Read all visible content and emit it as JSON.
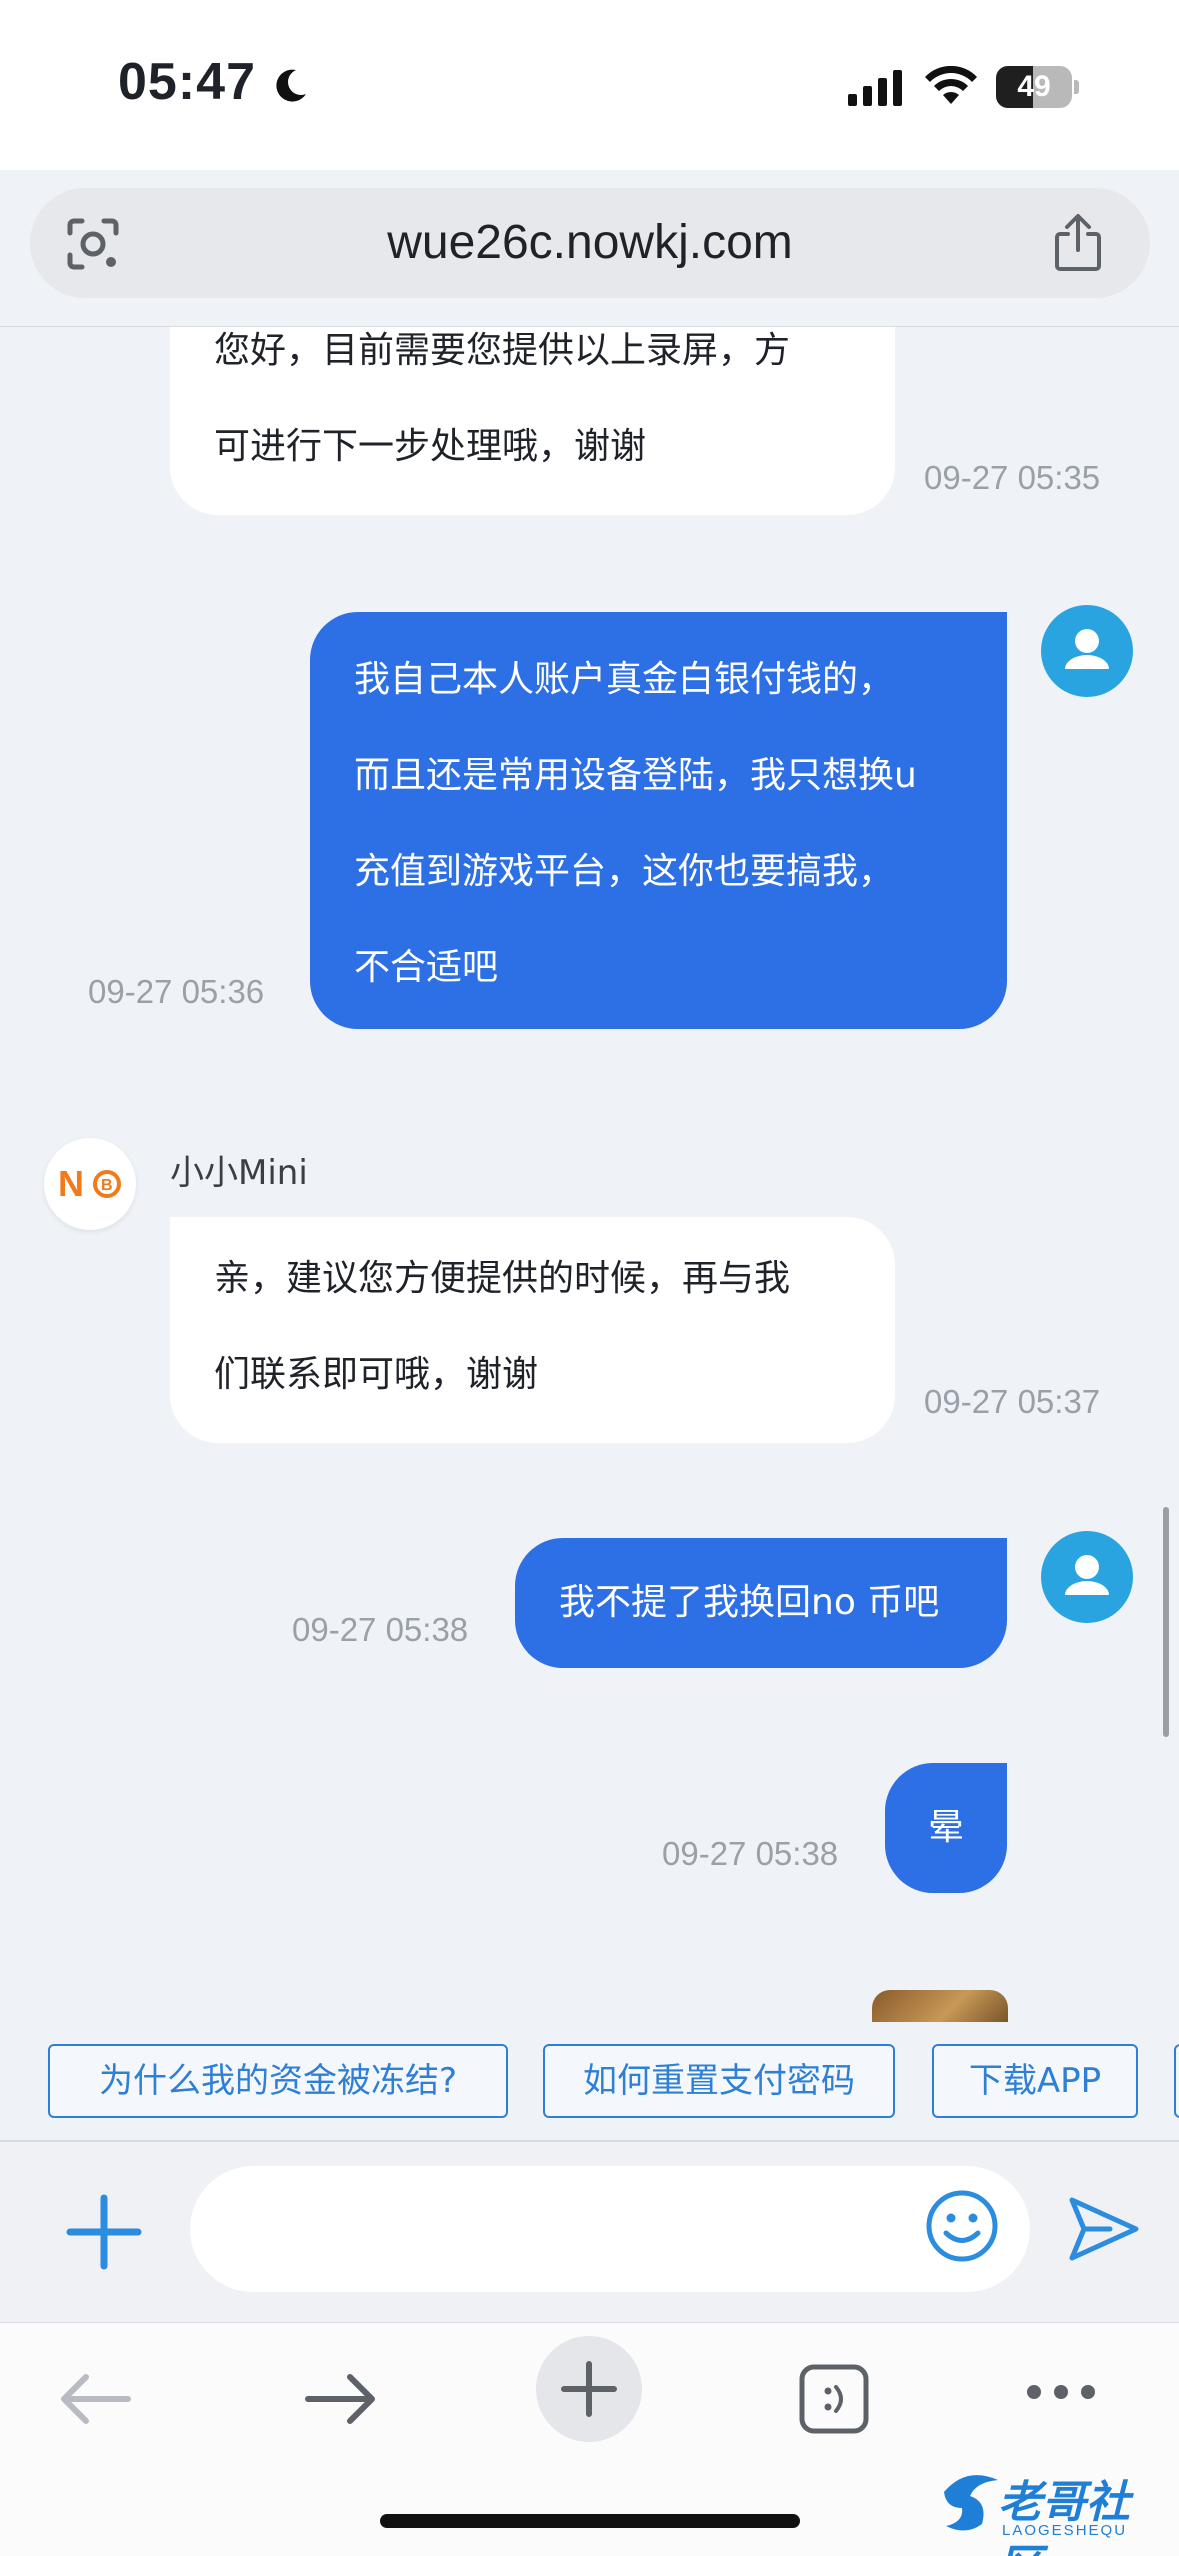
{
  "status": {
    "time": "05:47",
    "battery": "49",
    "battery_level": 0.49
  },
  "browser": {
    "url": "wue26c.nowkj.com"
  },
  "agent": {
    "name": "小小Mini",
    "avatar_text": "N",
    "avatar_coin": "B"
  },
  "messages": [
    {
      "sender": "agent",
      "lines": [
        "您好，目前需要您提供以上录屏，方",
        "可进行下一步处理哦，谢谢"
      ],
      "timestamp": "09-27 05:35"
    },
    {
      "sender": "user",
      "lines": [
        "我自己本人账户真金白银付钱的，",
        "而且还是常用设备登陆，我只想换u",
        "充值到游戏平台，这你也要搞我，",
        "不合适吧"
      ],
      "timestamp": "09-27 05:36"
    },
    {
      "sender": "agent",
      "lines": [
        "亲，建议您方便提供的时候，再与我",
        "们联系即可哦，谢谢"
      ],
      "timestamp": "09-27 05:37"
    },
    {
      "sender": "user",
      "lines": [
        "我不提了我换回no 币吧"
      ],
      "timestamp": "09-27 05:38"
    },
    {
      "sender": "user",
      "lines": [
        "晕"
      ],
      "timestamp": "09-27 05:38"
    }
  ],
  "quick_questions": [
    "为什么我的资金被冻结?",
    "如何重置支付密码",
    "下载APP"
  ],
  "input": {
    "placeholder": ""
  },
  "watermark": {
    "title": "老哥社区",
    "subtitle": "LAOGESHEQU"
  },
  "colors": {
    "user_bubble": "#2d6fe4",
    "agent_bubble": "#ffffff",
    "accent": "#2f7fd4",
    "background": "#eff3f8"
  },
  "icons": {
    "urlbar_left": "camera-lens-icon",
    "urlbar_right": "share-icon",
    "input_left": "plus-icon",
    "input_emoji": "smiley-icon",
    "input_send": "send-icon",
    "toolbar": [
      "back-arrow-icon",
      "forward-arrow-icon",
      "new-tab-icon",
      "tabs-icon",
      "more-icon"
    ]
  }
}
